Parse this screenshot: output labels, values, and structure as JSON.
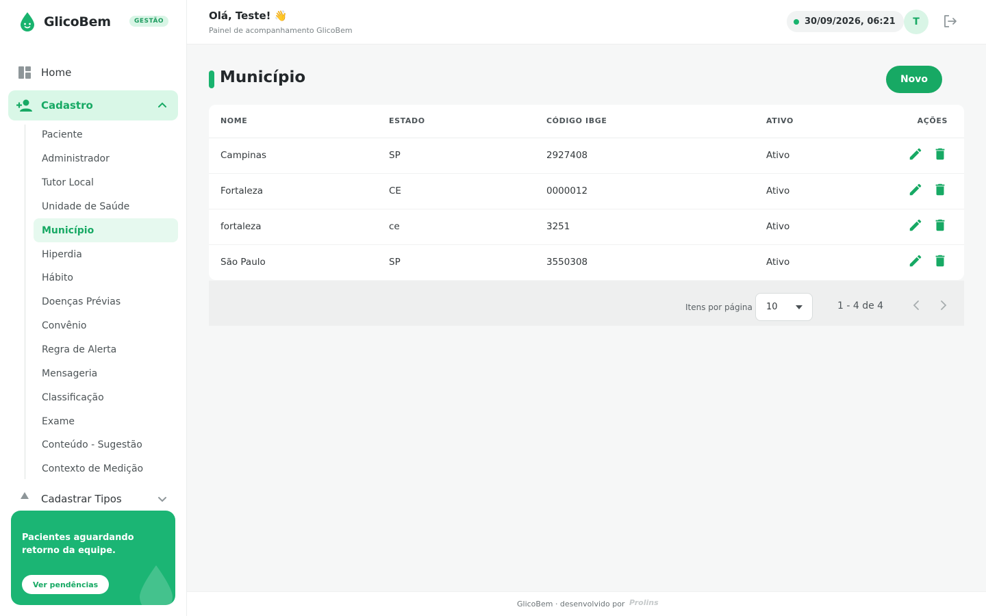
{
  "brand": {
    "name": "GlicoBem",
    "badge": "GESTÃO"
  },
  "colors": {
    "accent": "#17a964",
    "accent_light": "#d9f7e7"
  },
  "sidebar": {
    "home": {
      "label": "Home",
      "icon": "dashboard-icon"
    },
    "cadastro": {
      "label": "Cadastro",
      "icon": "add-user-icon",
      "expanded": true
    },
    "sub_items": [
      {
        "label": "Paciente"
      },
      {
        "label": "Administrador"
      },
      {
        "label": "Tutor Local"
      },
      {
        "label": "Unidade de Saúde"
      },
      {
        "label": "Município",
        "active": true
      },
      {
        "label": "Hiperdia"
      },
      {
        "label": "Hábito"
      },
      {
        "label": "Doenças Prévias"
      },
      {
        "label": "Convênio"
      },
      {
        "label": "Regra de Alerta"
      },
      {
        "label": "Mensageria"
      },
      {
        "label": "Classificação"
      },
      {
        "label": "Exame"
      },
      {
        "label": "Conteúdo - Sugestão"
      },
      {
        "label": "Contexto de Medição"
      }
    ],
    "tipos": {
      "label": "Cadastrar Tipos"
    },
    "promo": {
      "text": "Pacientes aguardando retorno da equipe.",
      "button": "Ver pendências"
    }
  },
  "header": {
    "greeting": "Olá, Teste! 👋",
    "subtitle": "Painel de acompanhamento GlicoBem",
    "datetime": "30/09/2026, 06:21",
    "avatar_initial": "T"
  },
  "page": {
    "title": "Município",
    "new_button": "Novo"
  },
  "table": {
    "columns": [
      "NOME",
      "ESTADO",
      "CÓDIGO IBGE",
      "ATIVO",
      "AÇÕES"
    ],
    "rows": [
      {
        "nome": "Campinas",
        "estado": "SP",
        "codigo": "2927408",
        "ativo": "Ativo"
      },
      {
        "nome": "Fortaleza",
        "estado": "CE",
        "codigo": "0000012",
        "ativo": "Ativo"
      },
      {
        "nome": "fortaleza",
        "estado": "ce",
        "codigo": "3251",
        "ativo": "Ativo"
      },
      {
        "nome": "São Paulo",
        "estado": "SP",
        "codigo": "3550308",
        "ativo": "Ativo"
      }
    ]
  },
  "pagination": {
    "label": "Itens por página",
    "page_size": "10",
    "range": "1 - 4 de 4"
  },
  "footer": {
    "text": "GlicoBem · desenvolvido por",
    "logo": "Prolins"
  }
}
